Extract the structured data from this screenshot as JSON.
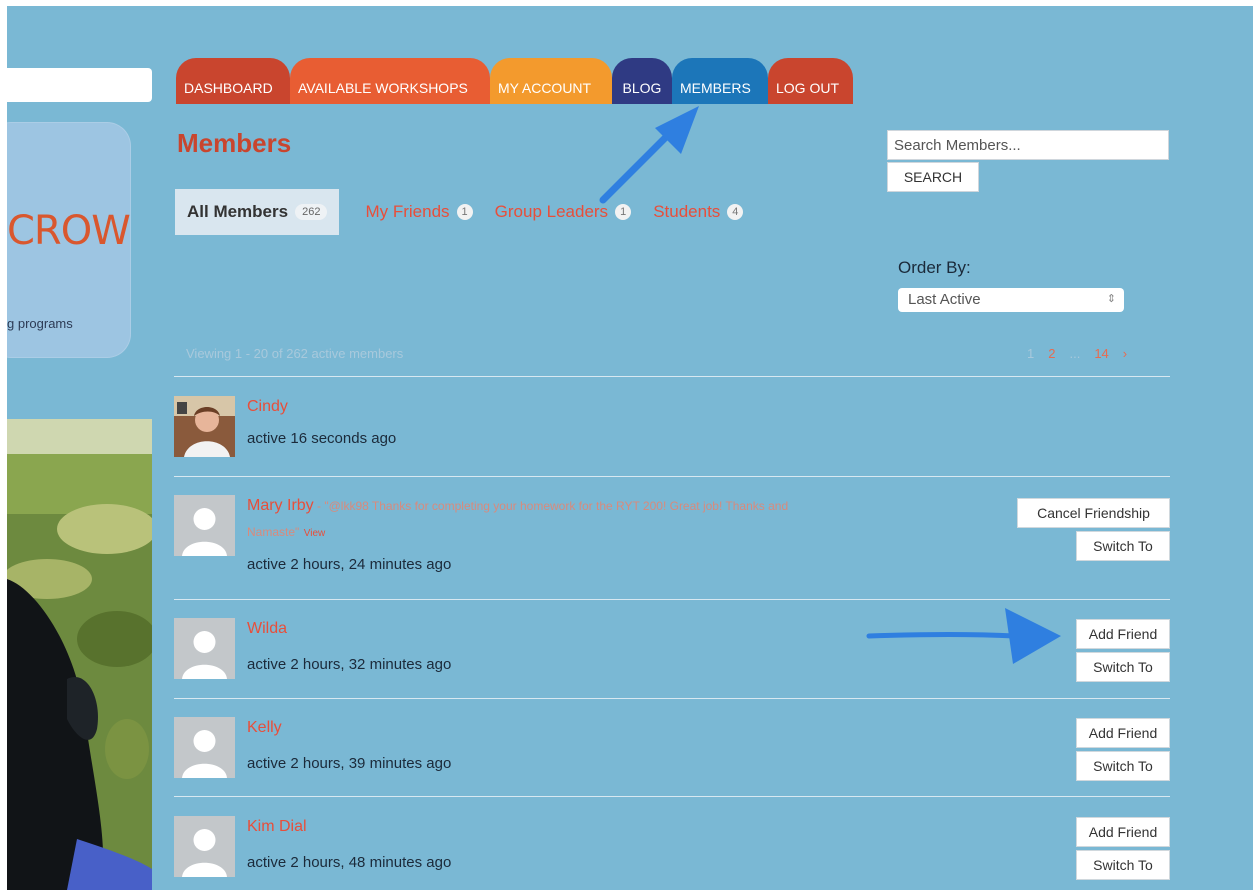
{
  "sidebar": {
    "logo_text": "CROW",
    "tagline": "g programs"
  },
  "nav": {
    "tabs": [
      "DASHBOARD",
      "AVAILABLE WORKSHOPS",
      "MY ACCOUNT",
      "BLOG",
      "MEMBERS",
      "LOG OUT"
    ]
  },
  "page": {
    "title": "Members"
  },
  "search": {
    "placeholder": "Search Members...",
    "button": "SEARCH"
  },
  "filters": [
    {
      "label": "All Members",
      "count": "262"
    },
    {
      "label": "My Friends",
      "count": "1"
    },
    {
      "label": "Group Leaders",
      "count": "1"
    },
    {
      "label": "Students",
      "count": "4"
    }
  ],
  "order": {
    "label": "Order By:",
    "selected": "Last Active"
  },
  "listing": {
    "viewing": "Viewing 1 - 20 of 262 active members",
    "pages": [
      "1",
      "2",
      "...",
      "14",
      "›"
    ]
  },
  "members": [
    {
      "name": "Cindy",
      "active": "active 16 seconds ago"
    },
    {
      "name": "Mary Irby",
      "quote": " - \"@lkk98 Thanks for completing your homework for the RYT 200! Great job! Thanks and",
      "quote2": "Namaste\"",
      "view": "View",
      "active": "active 2 hours, 24 minutes ago",
      "btn1": "Cancel Friendship",
      "btn2": "Switch To"
    },
    {
      "name": "Wilda",
      "active": "active 2 hours, 32 minutes ago",
      "btn1": "Add Friend",
      "btn2": "Switch To"
    },
    {
      "name": "Kelly",
      "active": "active 2 hours, 39 minutes ago",
      "btn1": "Add Friend",
      "btn2": "Switch To"
    },
    {
      "name": "Kim Dial",
      "active": "active 2 hours, 48 minutes ago",
      "btn1": "Add Friend",
      "btn2": "Switch To"
    }
  ],
  "colors": {
    "background": "#7ab8d4",
    "accent": "#e84e3a",
    "annotation_arrow": "#2f7fe0"
  }
}
